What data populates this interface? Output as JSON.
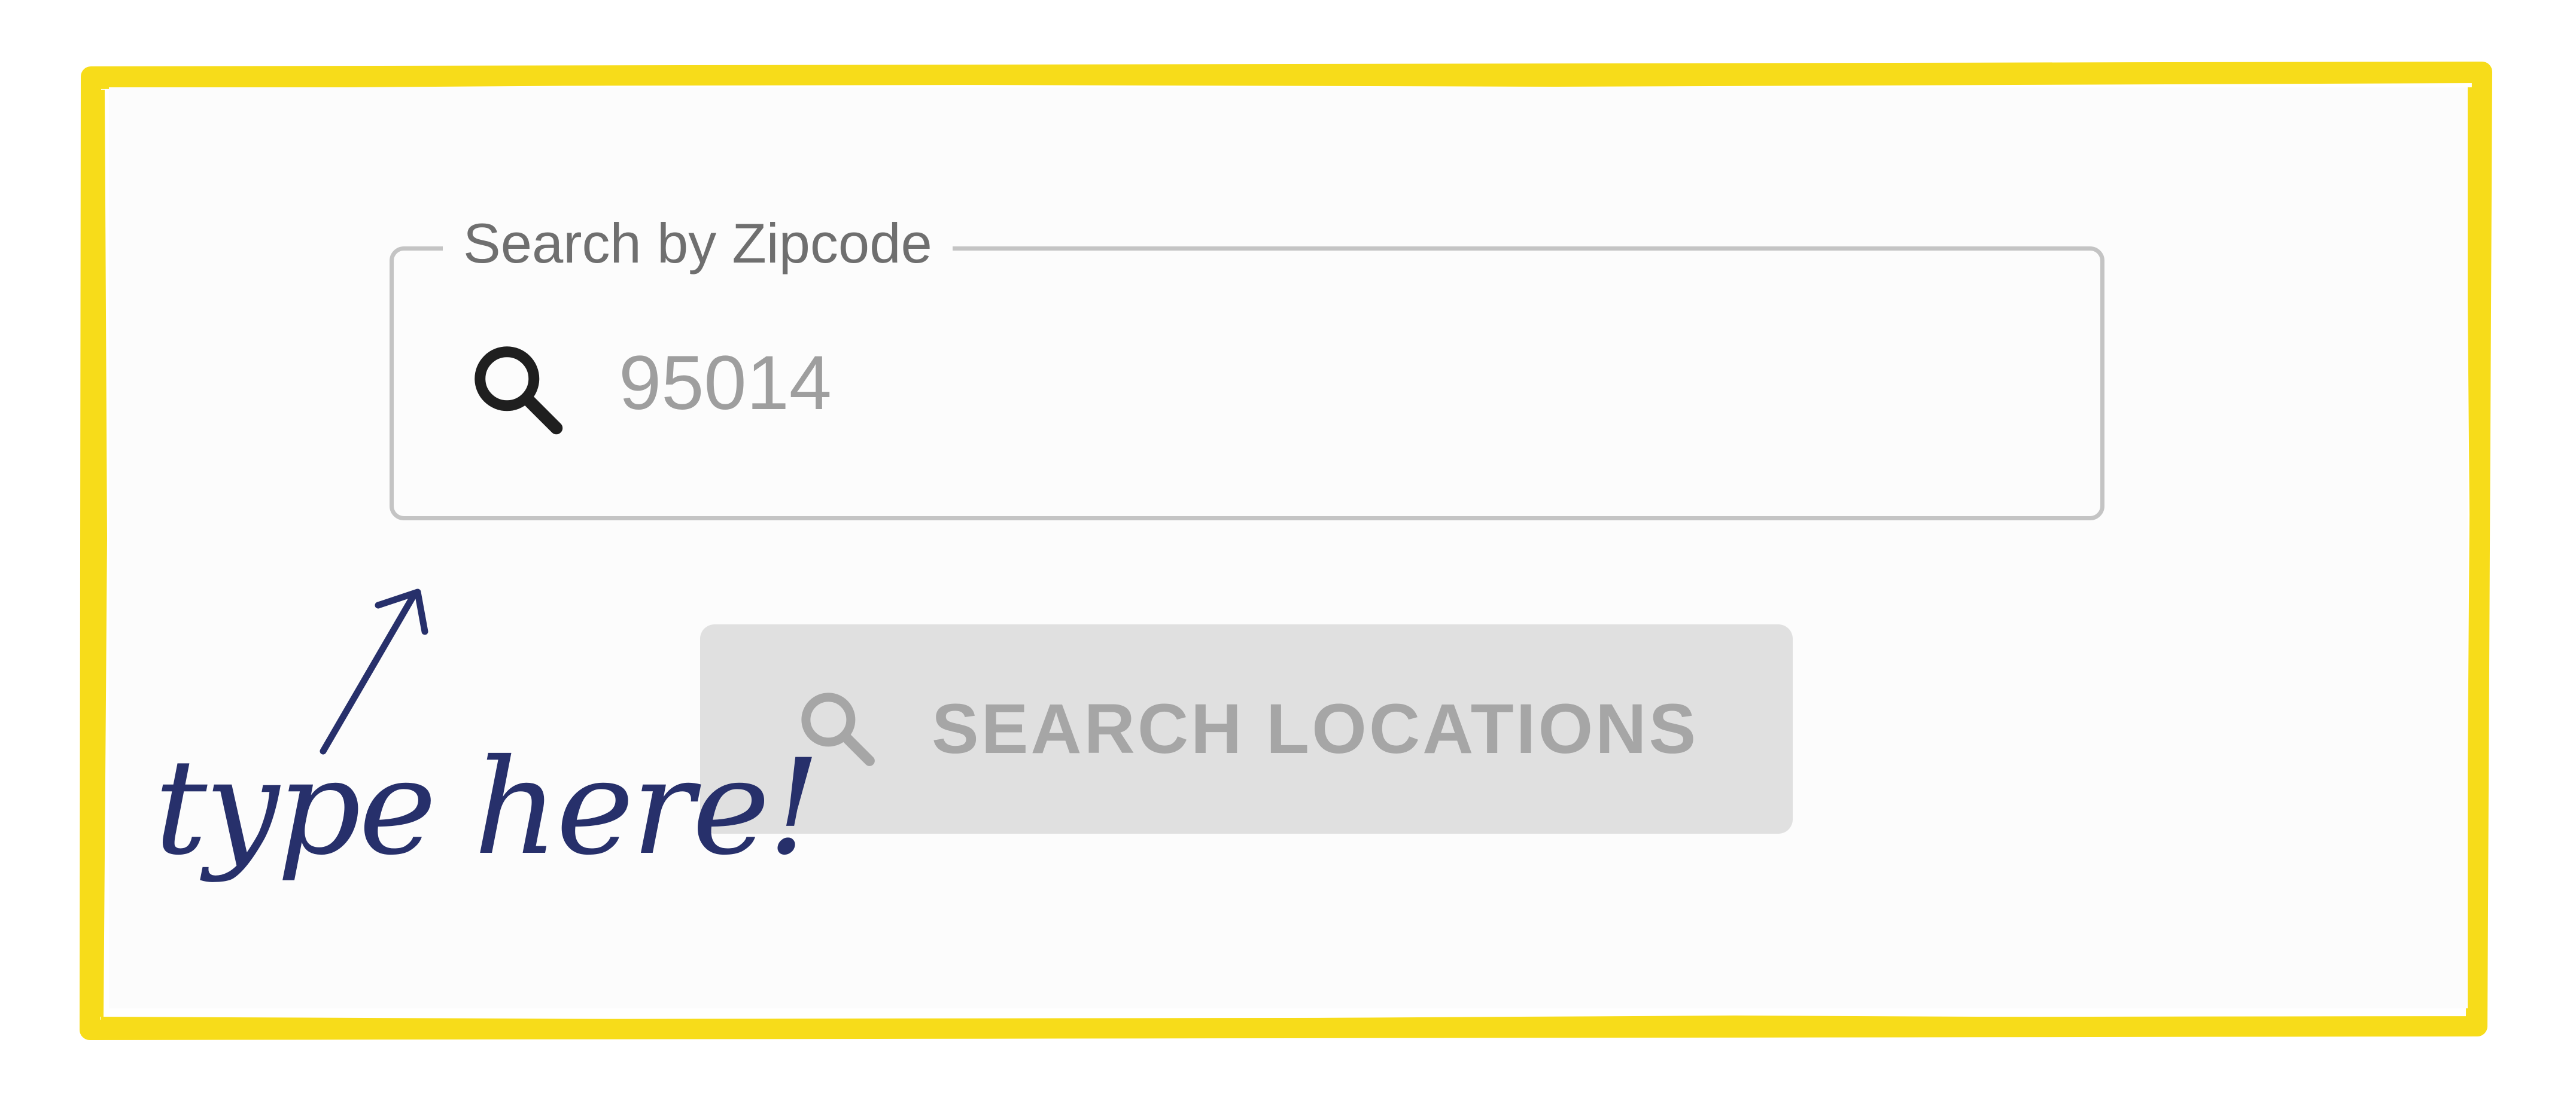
{
  "search_field": {
    "label": "Search by Zipcode",
    "value": "95014",
    "icon": "search-icon"
  },
  "search_button": {
    "label": "SEARCH LOCATIONS",
    "icon": "search-icon",
    "disabled": true
  },
  "annotation": {
    "text": "type here!",
    "icon": "arrow-up-right-icon"
  },
  "colors": {
    "frame": "#f7dc1a",
    "annotation_ink": "#27306b",
    "field_border": "#c4c4c4",
    "button_bg": "#e0e0e0",
    "button_text": "#a6a6a6"
  }
}
